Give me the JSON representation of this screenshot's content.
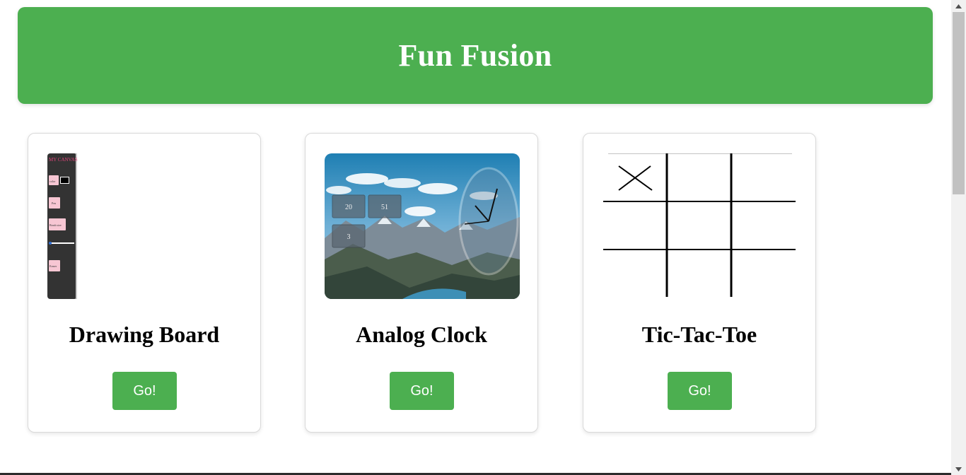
{
  "header": {
    "title": "Fun Fusion",
    "background_color": "#4caf50"
  },
  "cards": [
    {
      "title": "Drawing Board",
      "button_label": "Go!",
      "thumbnail": {
        "canvas_label": "MY CANVAS",
        "buttons": [
          "color",
          "Pen",
          "Brush size",
          "Eraser"
        ]
      }
    },
    {
      "title": "Analog Clock",
      "button_label": "Go!",
      "thumbnail": {
        "time_boxes": [
          "20",
          "51",
          "3"
        ]
      }
    },
    {
      "title": "Tic-Tac-Toe",
      "button_label": "Go!"
    }
  ],
  "accent_color": "#4caf50"
}
